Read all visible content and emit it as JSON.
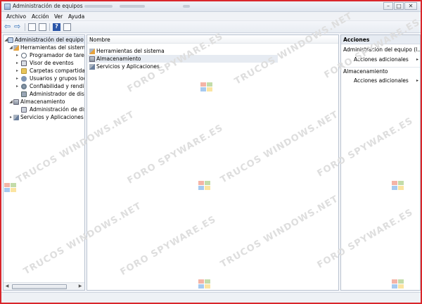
{
  "window": {
    "title": "Administración de equipos",
    "controls": {
      "minimize": "–",
      "maximize": "□",
      "close": "✕"
    }
  },
  "menubar": {
    "items": [
      "Archivo",
      "Acción",
      "Ver",
      "Ayuda"
    ]
  },
  "toolbar": {
    "back_glyph": "⇦",
    "forward_glyph": "⇨",
    "help_glyph": "?"
  },
  "tree": {
    "root": "Administración del equipo (loc",
    "system_tools": "Herramientas del sistema",
    "items": [
      "Programador de tareas",
      "Visor de eventos",
      "Carpetas compartidas",
      "Usuarios y grupos locale",
      "Confiabilidad y rendimi",
      "Administrador de dispo"
    ],
    "storage": "Almacenamiento",
    "disk_mgmt": "Administración de discos",
    "services": "Servicios y Aplicaciones",
    "expand_glyph": "▸",
    "collapse_glyph": "◢"
  },
  "center": {
    "column_header": "Nombre",
    "rows": [
      "Herramientas del sistema",
      "Almacenamiento",
      "Servicios y Aplicaciones"
    ]
  },
  "actions": {
    "header": "Acciones",
    "section1_title": "Administración del equipo (l...",
    "section1_item": "Acciones adicionales",
    "section2_title": "Almacenamiento",
    "section2_item": "Acciones adicionales",
    "chevron": "▸"
  },
  "watermark": {
    "foro": "FORO SPYWARE.ES",
    "trucos": "TRUCOS WINDOWS.NET"
  },
  "colors": {
    "frame_border": "#d9262b",
    "accent_blue": "#2f6fb8"
  }
}
